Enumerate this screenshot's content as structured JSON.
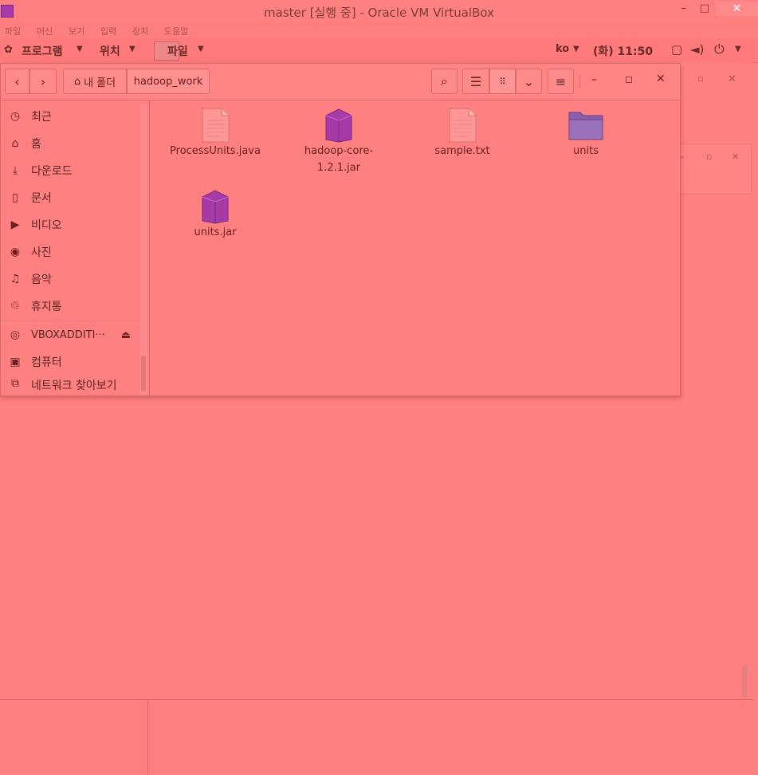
{
  "host": {
    "title": "master [실행 중] - Oracle VM VirtualBox",
    "menu": [
      "파일",
      "머신",
      "보기",
      "입력",
      "장치",
      "도움말"
    ],
    "controls": {
      "minimize": "–",
      "maximize": "□",
      "close": "✕"
    }
  },
  "gnome": {
    "apps_label": "프로그램",
    "places_label": "위치",
    "window_label": "파일",
    "lang": "ko",
    "clock": "(화) 11:50"
  },
  "fm": {
    "breadcrumb": {
      "home": "내 폴더",
      "current": "hadoop_work"
    },
    "sidebar": [
      {
        "icon": "recent-icon",
        "glyph": "◷",
        "label": "최근"
      },
      {
        "icon": "home-icon",
        "glyph": "⌂",
        "label": "홈"
      },
      {
        "icon": "download-icon",
        "glyph": "⤓",
        "label": "다운로드"
      },
      {
        "icon": "document-icon",
        "glyph": "▯",
        "label": "문서"
      },
      {
        "icon": "video-icon",
        "glyph": "▶",
        "label": "비디오"
      },
      {
        "icon": "camera-icon",
        "glyph": "◉",
        "label": "사진"
      },
      {
        "icon": "music-icon",
        "glyph": "♫",
        "label": "음악"
      },
      {
        "icon": "trash-icon",
        "glyph": "♲",
        "label": "휴지통"
      },
      {
        "icon": "disc-icon",
        "glyph": "◎",
        "label": "VBOXADDITI···"
      },
      {
        "icon": "computer-icon",
        "glyph": "▣",
        "label": "컴퓨터"
      },
      {
        "icon": "network-icon",
        "glyph": "⧉",
        "label": "네트워크 찾아보기"
      }
    ],
    "files": [
      {
        "name": "ProcessUnits.java",
        "type": "text"
      },
      {
        "name": "hadoop-core-1.2.1.jar",
        "type": "jar"
      },
      {
        "name": "sample.txt",
        "type": "text"
      },
      {
        "name": "units",
        "type": "folder"
      },
      {
        "name": "units.jar",
        "type": "jar"
      }
    ]
  },
  "colors": {
    "background": "#ff7f7f",
    "jar": "#a63aa8",
    "folder": "#8c5fae"
  }
}
